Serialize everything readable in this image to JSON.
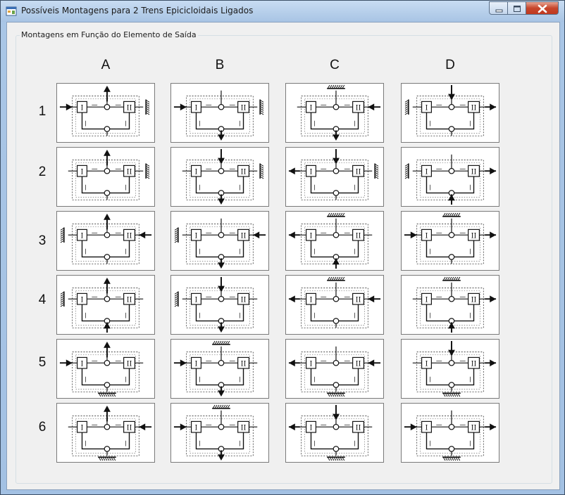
{
  "window": {
    "title": "Possíveis Montagens para 2 Trens Epicicloidais Ligados",
    "icon": "app-icon",
    "controls": [
      "minimize-icon",
      "maximize-icon",
      "close-icon"
    ]
  },
  "group": {
    "title": "Montagens em Função do Elemento de Saída"
  },
  "columns": [
    "A",
    "B",
    "C",
    "D"
  ],
  "rows": [
    "1",
    "2",
    "3",
    "4",
    "5",
    "6"
  ],
  "diagram_labels": {
    "first": "I",
    "second": "II"
  },
  "colors": {
    "titlebar": "#a8c4e4",
    "client": "#f0f0f0",
    "close": "#c7462c",
    "ink": "#1a1a1a"
  },
  "cells": [
    [
      {
        "left": "in",
        "top": "out",
        "bottom": "plain",
        "right": "fixed"
      },
      {
        "left": "in",
        "top": "plain",
        "bottom": "out",
        "right": "fixed"
      },
      {
        "left": "plain",
        "top": "fixed",
        "bottom": "out",
        "right": "in"
      },
      {
        "left": "fixed",
        "top": "in",
        "bottom": "plain",
        "right": "out"
      }
    ],
    [
      {
        "left": "plain",
        "top": "out",
        "bottom": "plain",
        "right": "fixed"
      },
      {
        "left": "plain",
        "top": "in",
        "bottom": "out",
        "right": "fixed"
      },
      {
        "left": "out",
        "top": "in",
        "bottom": "plain",
        "right": "fixed"
      },
      {
        "left": "fixed",
        "top": "plain",
        "bottom": "in",
        "right": "out"
      }
    ],
    [
      {
        "left": "fixed",
        "top": "out",
        "bottom": "plain",
        "right": "in"
      },
      {
        "left": "fixed",
        "top": "plain",
        "bottom": "out",
        "right": "in"
      },
      {
        "left": "out",
        "top": "fixed",
        "bottom": "in",
        "right": "plain"
      },
      {
        "left": "in",
        "top": "fixed",
        "bottom": "plain",
        "right": "out"
      }
    ],
    [
      {
        "left": "fixed",
        "top": "out",
        "bottom": "in",
        "right": "plain"
      },
      {
        "left": "fixed",
        "top": "in",
        "bottom": "out",
        "right": "plain"
      },
      {
        "left": "out",
        "top": "fixed",
        "bottom": "plain",
        "right": "in"
      },
      {
        "left": "plain",
        "top": "fixed",
        "bottom": "in",
        "right": "out"
      }
    ],
    [
      {
        "left": "in",
        "top": "out",
        "bottom": "fixed",
        "right": "plain"
      },
      {
        "left": "in",
        "top": "fixed",
        "bottom": "out",
        "right": "plain"
      },
      {
        "left": "out",
        "top": "plain",
        "bottom": "fixed",
        "right": "in"
      },
      {
        "left": "plain",
        "top": "in",
        "bottom": "fixed",
        "right": "out"
      }
    ],
    [
      {
        "left": "plain",
        "top": "out",
        "bottom": "fixed",
        "right": "in"
      },
      {
        "left": "in",
        "top": "fixed",
        "bottom": "out",
        "right": "plain"
      },
      {
        "left": "out",
        "top": "in",
        "bottom": "fixed",
        "right": "plain"
      },
      {
        "left": "in",
        "top": "plain",
        "bottom": "fixed",
        "right": "out"
      }
    ]
  ]
}
